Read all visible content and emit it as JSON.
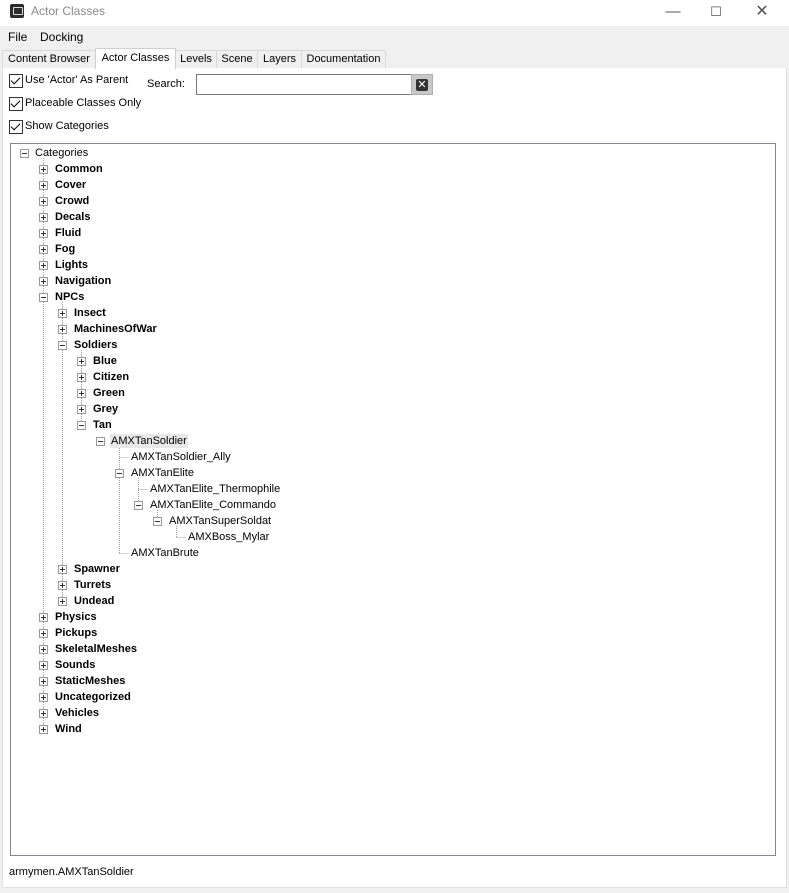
{
  "window": {
    "title": "Actor Classes",
    "minimize_glyph": "—",
    "maximize_glyph": "☐",
    "close_glyph": "✕"
  },
  "menu": {
    "file": "File",
    "docking": "Docking"
  },
  "tabs": [
    "Content Browser",
    "Actor Classes",
    "Levels",
    "Scene",
    "Layers",
    "Documentation"
  ],
  "options": {
    "use_actor_parent": "Use 'Actor' As Parent",
    "placeable_only": "Placeable Classes Only",
    "show_categories": "Show Categories"
  },
  "search": {
    "label": "Search:",
    "value": ""
  },
  "tree": {
    "root": "Categories",
    "categories_top": [
      "Common",
      "Cover",
      "Crowd",
      "Decals",
      "Fluid",
      "Fog",
      "Lights",
      "Navigation"
    ],
    "npcs": "NPCs",
    "npc_children_top": [
      "Insect",
      "MachinesOfWar"
    ],
    "soldiers": "Soldiers",
    "soldier_children": [
      "Blue",
      "Citizen",
      "Green",
      "Grey"
    ],
    "tan": "Tan",
    "amx_tan_soldier": "AMXTanSoldier",
    "amx_tan_soldier_ally": "AMXTanSoldier_Ally",
    "amx_tan_elite": "AMXTanElite",
    "amx_tan_elite_thermophile": "AMXTanElite_Thermophile",
    "amx_tan_elite_commando": "AMXTanElite_Commando",
    "amx_tan_super_soldat": "AMXTanSuperSoldat",
    "amx_boss_mylar": "AMXBoss_Mylar",
    "amx_tan_brute": "AMXTanBrute",
    "npc_children_bottom": [
      "Spawner",
      "Turrets",
      "Undead"
    ],
    "categories_bottom": [
      "Physics",
      "Pickups",
      "SkeletalMeshes",
      "Sounds",
      "StaticMeshes",
      "Uncategorized",
      "Vehicles",
      "Wind"
    ]
  },
  "status": "armymen.AMXTanSoldier"
}
